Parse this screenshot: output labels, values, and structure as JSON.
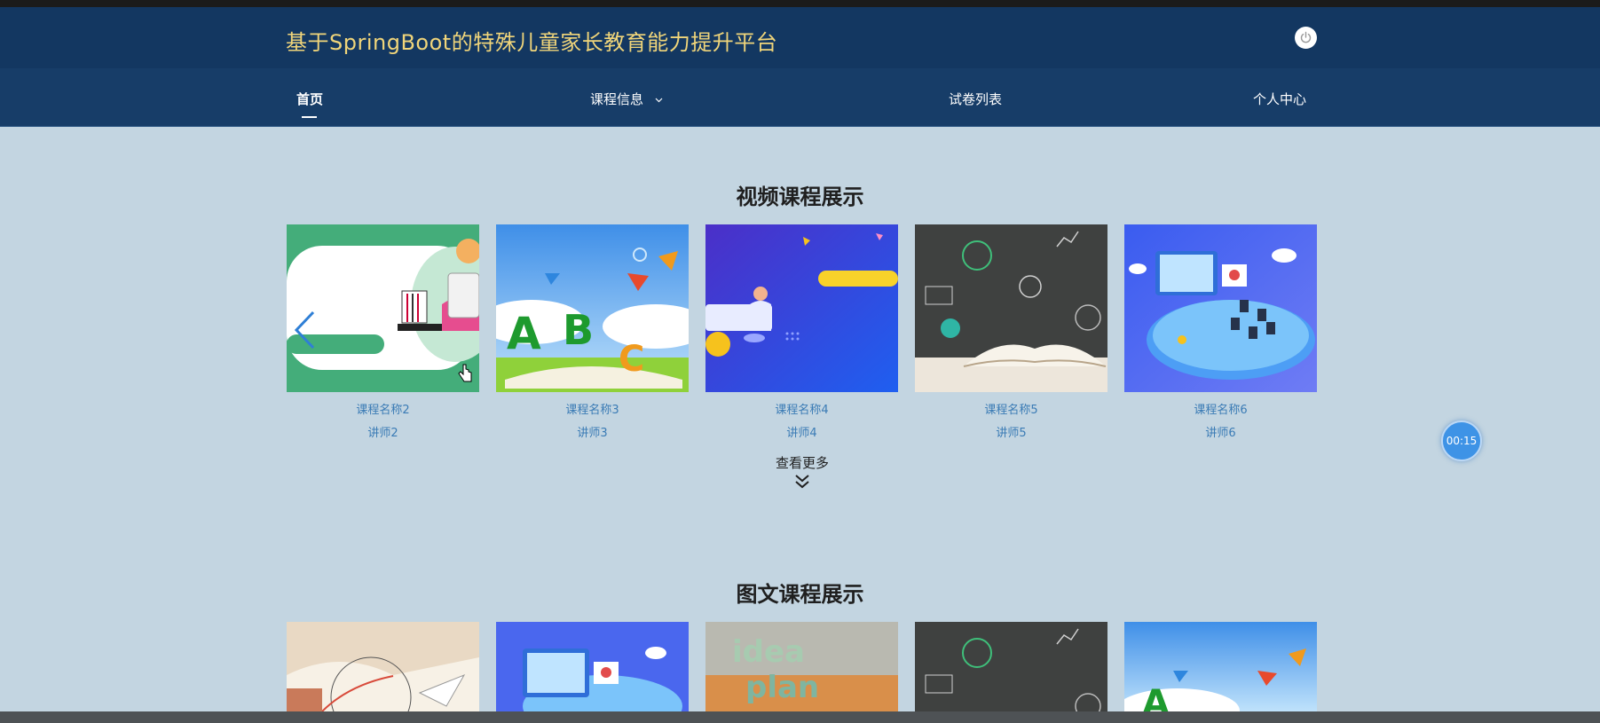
{
  "header": {
    "title": "基于SpringBoot的特殊儿童家长教育能力提升平台"
  },
  "nav": {
    "items": [
      {
        "label": "首页"
      },
      {
        "label": "课程信息"
      },
      {
        "label": "试卷列表"
      },
      {
        "label": "个人中心"
      }
    ]
  },
  "video_section": {
    "title": "视频课程展示",
    "courses": [
      {
        "name": "课程名称2",
        "teacher": "讲师2"
      },
      {
        "name": "课程名称3",
        "teacher": "讲师3"
      },
      {
        "name": "课程名称4",
        "teacher": "讲师4"
      },
      {
        "name": "课程名称5",
        "teacher": "讲师5"
      },
      {
        "name": "课程名称6",
        "teacher": "讲师6"
      }
    ],
    "more_label": "查看更多"
  },
  "article_section": {
    "title": "图文课程展示"
  },
  "timer": {
    "label": "00:15"
  },
  "colors": {
    "header_bg": "#133761",
    "nav_bg": "#173d68",
    "page_bg": "#c3d5e1",
    "title_gold": "#f0d57a",
    "link_blue": "#3a7bb5"
  }
}
